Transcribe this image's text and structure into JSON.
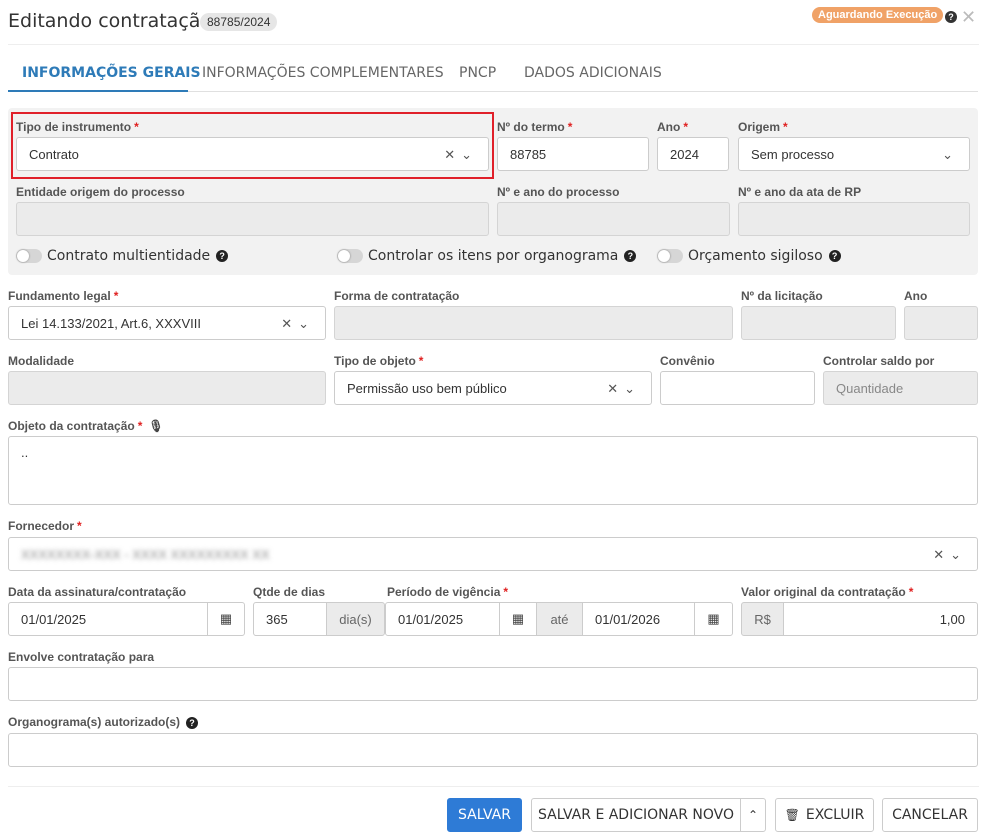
{
  "header": {
    "title": "Editando contratação",
    "id_badge": "88785/2024",
    "status": "Aguardando Execução"
  },
  "tabs": [
    {
      "label": "INFORMAÇÕES GERAIS",
      "active": true
    },
    {
      "label": "INFORMAÇÕES COMPLEMENTARES",
      "active": false
    },
    {
      "label": "PNCP",
      "active": false
    },
    {
      "label": "DADOS ADICIONAIS",
      "active": false
    }
  ],
  "form": {
    "tipo_instrumento": {
      "label": "Tipo de instrumento",
      "value": "Contrato"
    },
    "numero_termo": {
      "label": "Nº do termo",
      "value": "88785"
    },
    "ano": {
      "label": "Ano",
      "value": "2024"
    },
    "origem": {
      "label": "Origem",
      "value": "Sem processo"
    },
    "entidade_origem": {
      "label": "Entidade origem do processo",
      "value": ""
    },
    "numero_processo": {
      "label": "Nº e ano do processo",
      "value": ""
    },
    "numero_ata": {
      "label": "Nº e ano da ata de RP",
      "value": ""
    },
    "toggles": {
      "multientidade": "Contrato multientidade",
      "organograma": "Controlar os itens por organograma",
      "sigiloso": "Orçamento sigiloso"
    },
    "fundamento_legal": {
      "label": "Fundamento legal",
      "value": "Lei 14.133/2021, Art.6, XXXVIII"
    },
    "forma_contratacao": {
      "label": "Forma de contratação",
      "value": ""
    },
    "numero_licitacao": {
      "label": "Nº da licitação",
      "value": ""
    },
    "ano_licitacao": {
      "label": "Ano",
      "value": ""
    },
    "modalidade": {
      "label": "Modalidade",
      "value": ""
    },
    "tipo_objeto": {
      "label": "Tipo de objeto",
      "value": "Permissão uso bem público"
    },
    "convenio": {
      "label": "Convênio",
      "value": ""
    },
    "controlar_saldo": {
      "label": "Controlar saldo por",
      "value": "Quantidade"
    },
    "objeto": {
      "label": "Objeto da contratação",
      "value": ".."
    },
    "fornecedor": {
      "label": "Fornecedor",
      "value": "XXXXXXXX-XXX - XXXX XXXXXXXXX XX"
    },
    "data_assinatura": {
      "label": "Data da assinatura/contratação",
      "value": "01/01/2025"
    },
    "qtde_dias": {
      "label": "Qtde de dias",
      "value": "365",
      "unit": "dia(s)"
    },
    "periodo_vigencia": {
      "label": "Período de vigência",
      "start": "01/01/2025",
      "separator": "até",
      "end": "01/01/2026"
    },
    "valor_original": {
      "label": "Valor original da contratação",
      "currency": "R$",
      "value": "1,00"
    },
    "envolve": {
      "label": "Envolve contratação para",
      "value": ""
    },
    "organogramas": {
      "label": "Organograma(s) autorizado(s)",
      "value": ""
    }
  },
  "footer": {
    "save": "SALVAR",
    "save_new": "SALVAR E ADICIONAR NOVO",
    "delete": "EXCLUIR",
    "cancel": "CANCELAR"
  }
}
